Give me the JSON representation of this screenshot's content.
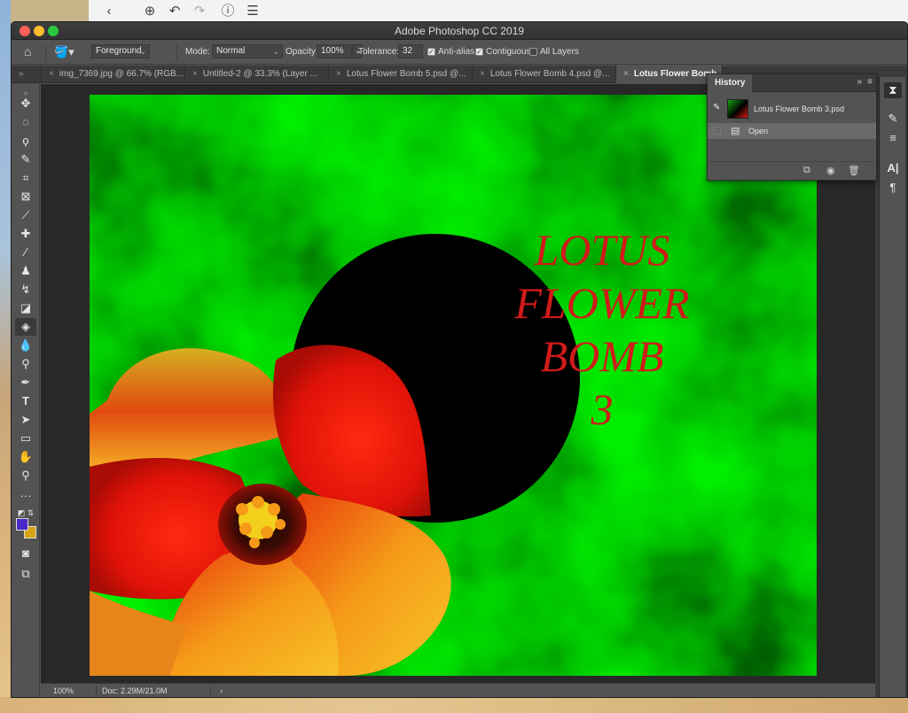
{
  "app": {
    "title": "Adobe Photoshop CC 2019"
  },
  "top_strip": {
    "icons": [
      "back-icon",
      "add-icon",
      "undo-icon",
      "redo-icon",
      "info-icon",
      "list-icon"
    ]
  },
  "options_bar": {
    "fill_source": "Foreground",
    "mode_label": "Mode:",
    "mode_value": "Normal",
    "opacity_label": "Opacity:",
    "opacity_value": "100%",
    "tolerance_label": "Tolerance:",
    "tolerance_value": "32",
    "anti_alias_label": "Anti-alias",
    "anti_alias_checked": true,
    "contiguous_label": "Contiguous",
    "contiguous_checked": true,
    "all_layers_label": "All Layers",
    "all_layers_checked": false
  },
  "tabs": [
    {
      "label": "img_7369.jpg @ 66.7% (RGB...",
      "active": false
    },
    {
      "label": "Untitled-2 @ 33.3% (Layer ...",
      "active": false
    },
    {
      "label": "Lotus Flower Bomb 5.psd @...",
      "active": false
    },
    {
      "label": "Lotus Flower Bomb 4.psd @...",
      "active": false
    },
    {
      "label": "Lotus Flower Bomb",
      "active": true
    }
  ],
  "tools": [
    "move-icon",
    "marquee-icon",
    "lasso-icon",
    "quick-select-icon",
    "crop-icon",
    "frame-icon",
    "eyedropper-icon",
    "healing-brush-icon",
    "brush-icon",
    "clone-stamp-icon",
    "history-brush-icon",
    "eraser-icon",
    "paint-bucket-icon",
    "blur-icon",
    "dodge-icon",
    "pen-icon",
    "type-icon",
    "path-select-icon",
    "rectangle-icon",
    "hand-icon",
    "zoom-icon",
    "more-tools-icon"
  ],
  "colors": {
    "foreground": "#4b28c8",
    "background": "#d6a414",
    "artwork_text": "#d11a1a",
    "artwork_green": "#0fa00f"
  },
  "artwork": {
    "line1": "LOTUS",
    "line2": "FLOWER",
    "line3": "BOMB",
    "line4": "3"
  },
  "history": {
    "tab_label": "History",
    "snapshot_label": "Lotus Flower Bomb 3.psd",
    "state_label": "Open"
  },
  "status": {
    "zoom": "100%",
    "doc_info": "Doc: 2.29M/21.0M"
  }
}
